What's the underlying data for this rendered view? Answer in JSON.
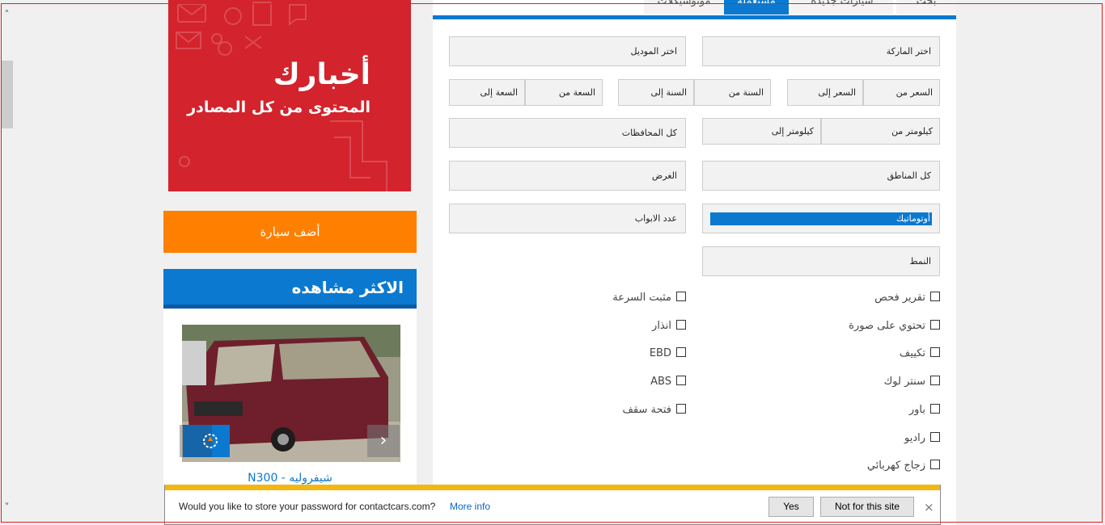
{
  "tabs": [
    "بحث",
    "سيارات جديدة",
    "مستعملة",
    "موتوسيكلات"
  ],
  "form": {
    "brand": "اختر الماركة",
    "model": "اختر الموديل",
    "price_from": "السعر من",
    "price_to": "السعر إلى",
    "year_from": "السنة من",
    "year_to": "السنة إلى",
    "engine_from": "السعة من",
    "engine_to": "السعة إلى",
    "km_from": "كيلومتر من",
    "km_to": "كيلومتر إلى",
    "governorate": "كل المحافظات",
    "area": "كل المناطق",
    "purpose": "الغرض",
    "transmission": "أوتوماتيك",
    "doors": "عدد الابواب",
    "body_style": "النمط"
  },
  "features_right": [
    "تقرير فحص",
    "تحتوي على صورة",
    "تكييف",
    "سنتر لوك",
    "باور",
    "راديو",
    "زجاج كهربائي"
  ],
  "features_left": [
    "مثبت السرعة",
    "انذار",
    "EBD",
    "ABS",
    "فتحة سقف"
  ],
  "banner": {
    "logo": "أخبارك",
    "tagline": "المحتوى من كل المصادر"
  },
  "sidebar": {
    "add_car": "أضف سيارة",
    "most_viewed": "الاكثر مشاهده",
    "car_title": "شيفروليه - N300"
  },
  "password_prompt": {
    "question": "Would you like to store your password for contactcars.com?",
    "more_info": "More info",
    "yes": "Yes",
    "not_for_site": "Not for this site",
    "close": "×"
  },
  "colors": {
    "brand_blue": "#0b79d0",
    "orange": "#ff7f00",
    "banner_red": "#d3232c",
    "prompt_yellow": "#f3b713"
  },
  "icons": {
    "scroll_up": "chevron-up-icon",
    "scroll_down": "chevron-down-icon",
    "prev": "chevron-left-icon",
    "next": "chevron-right-icon"
  }
}
